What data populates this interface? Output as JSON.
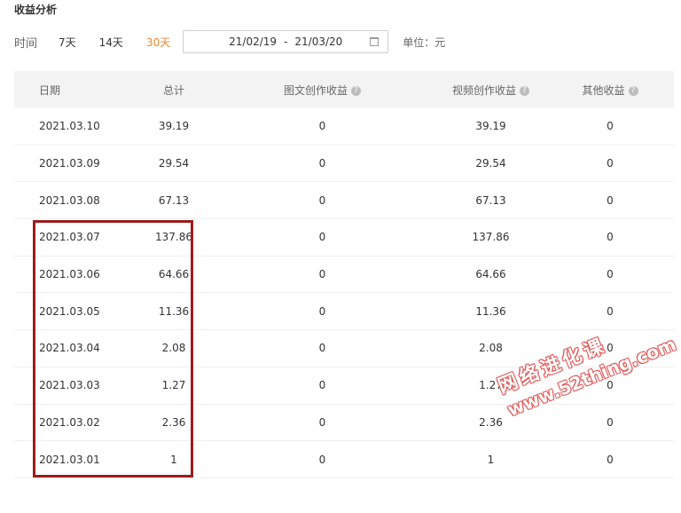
{
  "page": {
    "title": "收益分析"
  },
  "filter": {
    "label": "时间",
    "ranges": [
      "7天",
      "14天",
      "30天"
    ],
    "active_range": "30天",
    "date_start": "21/02/19",
    "date_sep": "-",
    "date_end": "21/03/20",
    "unit": "单位：元"
  },
  "table": {
    "headers": {
      "date": "日期",
      "total": "总计",
      "graphic": "图文创作收益",
      "video": "视频创作收益",
      "other": "其他收益"
    },
    "rows": [
      {
        "date": "2021.03.10",
        "total": "39.19",
        "graphic": "0",
        "video": "39.19",
        "other": "0"
      },
      {
        "date": "2021.03.09",
        "total": "29.54",
        "graphic": "0",
        "video": "29.54",
        "other": "0"
      },
      {
        "date": "2021.03.08",
        "total": "67.13",
        "graphic": "0",
        "video": "67.13",
        "other": "0"
      },
      {
        "date": "2021.03.07",
        "total": "137.86",
        "graphic": "0",
        "video": "137.86",
        "other": "0"
      },
      {
        "date": "2021.03.06",
        "total": "64.66",
        "graphic": "0",
        "video": "64.66",
        "other": "0"
      },
      {
        "date": "2021.03.05",
        "total": "11.36",
        "graphic": "0",
        "video": "11.36",
        "other": "0"
      },
      {
        "date": "2021.03.04",
        "total": "2.08",
        "graphic": "0",
        "video": "2.08",
        "other": "0"
      },
      {
        "date": "2021.03.03",
        "total": "1.27",
        "graphic": "0",
        "video": "1.27",
        "other": "0"
      },
      {
        "date": "2021.03.02",
        "total": "2.36",
        "graphic": "0",
        "video": "2.36",
        "other": "0"
      },
      {
        "date": "2021.03.01",
        "total": "1",
        "graphic": "0",
        "video": "1",
        "other": "0"
      }
    ]
  },
  "watermark": {
    "title": "网络进化课",
    "url": "www.52thing.com"
  },
  "colors": {
    "active": "#e8862d",
    "highlight_border": "#9c1c1c",
    "header_bg": "#f3f3f3"
  }
}
